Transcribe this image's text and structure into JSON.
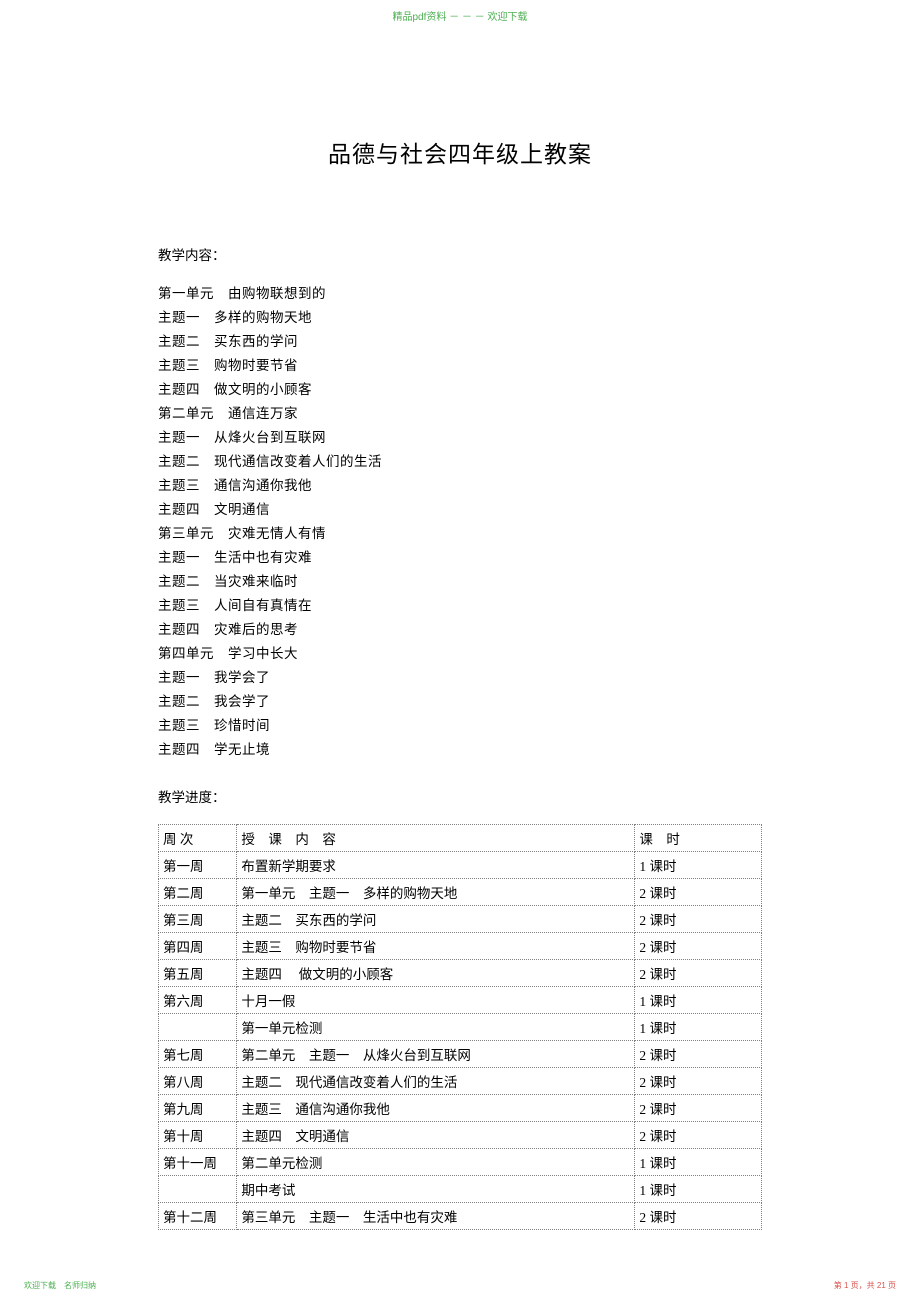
{
  "watermark": {
    "top": "精品pdf资料 － － － 欢迎下载",
    "footer_left": "欢迎下载　名师归纳",
    "footer_right": "第 1 页，共 21 页"
  },
  "title": "品德与社会四年级上教案",
  "sections": {
    "teaching_content_label": "教学内容：",
    "teaching_schedule_label": "教学进度："
  },
  "content_lines": [
    "第一单元　由购物联想到的",
    "主题一　多样的购物天地",
    "主题二　买东西的学问",
    "主题三　购物时要节省",
    "主题四　做文明的小顾客",
    "第二单元　通信连万家",
    "主题一　从烽火台到互联网",
    "主题二　现代通信改变着人们的生活",
    "主题三　通信沟通你我他",
    "主题四　文明通信",
    "第三单元　灾难无情人有情",
    "主题一　生活中也有灾难",
    "主题二　当灾难来临时",
    "主题三　人间自有真情在",
    "主题四　灾难后的思考",
    "第四单元　学习中长大",
    "主题一　我学会了",
    "主题二　我会学了",
    "主题三　珍惜时间",
    "主题四　学无止境"
  ],
  "table": {
    "header": {
      "week": "周 次",
      "content": "授　课　内　容",
      "time": "课　时"
    },
    "rows": [
      {
        "week": "第一周",
        "content": "布置新学期要求",
        "time": "1 课时"
      },
      {
        "week": "第二周",
        "content": "第一单元　主题一　多样的购物天地",
        "time": "2 课时"
      },
      {
        "week": "第三周",
        "content": "主题二　买东西的学问",
        "time": "2 课时"
      },
      {
        "week": "第四周",
        "content": "主题三　购物时要节省",
        "time": "2 课时"
      },
      {
        "week": "第五周",
        "content": "主题四　 做文明的小顾客",
        "time": "2 课时"
      },
      {
        "week": "第六周",
        "content": "十月一假",
        "time": "1 课时"
      },
      {
        "week": "",
        "content": "第一单元检测",
        "time": "1 课时"
      },
      {
        "week": "第七周",
        "content": "第二单元　主题一　从烽火台到互联网",
        "time": "2 课时"
      },
      {
        "week": "第八周",
        "content": "主题二　现代通信改变着人们的生活",
        "time": "2 课时"
      },
      {
        "week": "第九周",
        "content": "主题三　通信沟通你我他",
        "time": "2 课时"
      },
      {
        "week": "第十周",
        "content": "主题四　文明通信",
        "time": "2 课时"
      },
      {
        "week": "第十一周",
        "content": "第二单元检测",
        "time": "1 课时"
      },
      {
        "week": "",
        "content": "期中考试",
        "time": "1 课时"
      },
      {
        "week": "第十二周",
        "content": "第三单元　主题一　生活中也有灾难",
        "time": "2 课时"
      }
    ]
  }
}
